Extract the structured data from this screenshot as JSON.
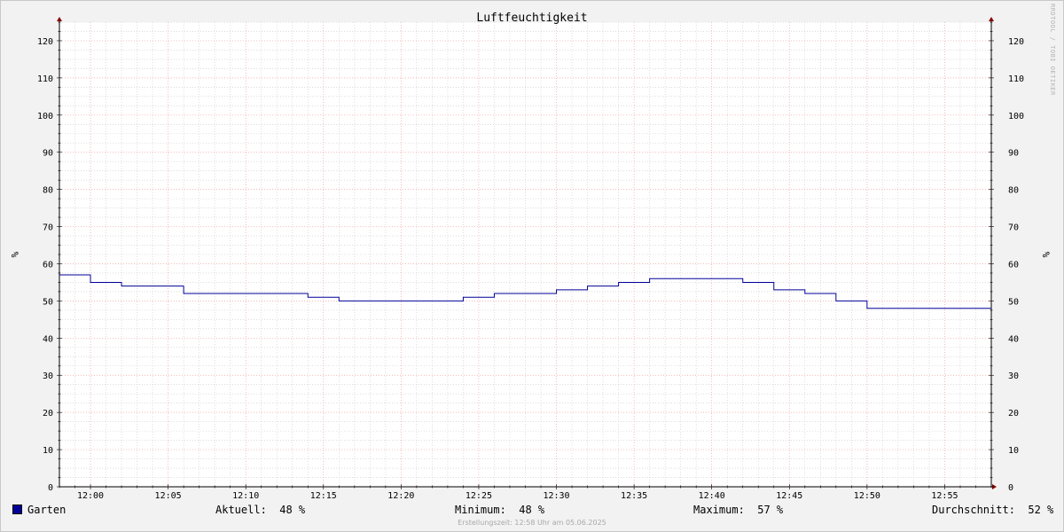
{
  "chart_data": {
    "type": "line",
    "title": "Luftfeuchtigkeit",
    "ylabel": "%",
    "ylabel_right": "%",
    "ylim": [
      0,
      125
    ],
    "yticks": [
      0,
      10,
      20,
      30,
      40,
      50,
      60,
      70,
      80,
      90,
      100,
      110,
      120
    ],
    "x_range_minutes": [
      -2,
      58
    ],
    "xticks": [
      "12:00",
      "12:05",
      "12:10",
      "12:15",
      "12:20",
      "12:25",
      "12:30",
      "12:35",
      "12:40",
      "12:45",
      "12:50",
      "12:55"
    ],
    "grid": true,
    "series": [
      {
        "name": "Garten",
        "color": "#000099",
        "x": [
          "11:58",
          "12:00",
          "12:02",
          "12:06",
          "12:14",
          "12:16",
          "12:24",
          "12:26",
          "12:30",
          "12:32",
          "12:34",
          "12:36",
          "12:42",
          "12:44",
          "12:46",
          "12:48",
          "12:50",
          "12:58"
        ],
        "values": [
          57,
          55,
          54,
          52,
          51,
          50,
          51,
          52,
          53,
          54,
          55,
          56,
          55,
          53,
          52,
          50,
          48,
          48
        ]
      }
    ]
  },
  "legend": {
    "series_name": "Garten",
    "aktuell_label": "Aktuell:",
    "aktuell_value": "48 %",
    "minimum_label": "Minimum:",
    "minimum_value": "48 %",
    "maximum_label": "Maximum:",
    "maximum_value": "57 %",
    "durchschnitt_label": "Durchschnitt:",
    "durchschnitt_value": "52 %"
  },
  "footer": "Erstellungszeit: 12:58 Uhr am 05.06.2025",
  "watermark": "RRDTOOL / TOBI OETIKER",
  "colors": {
    "series": "#000099",
    "major_grid": "#f0a0a0",
    "minor_grid": "#c8c8c8",
    "axis_arrow": "#8b0000"
  }
}
